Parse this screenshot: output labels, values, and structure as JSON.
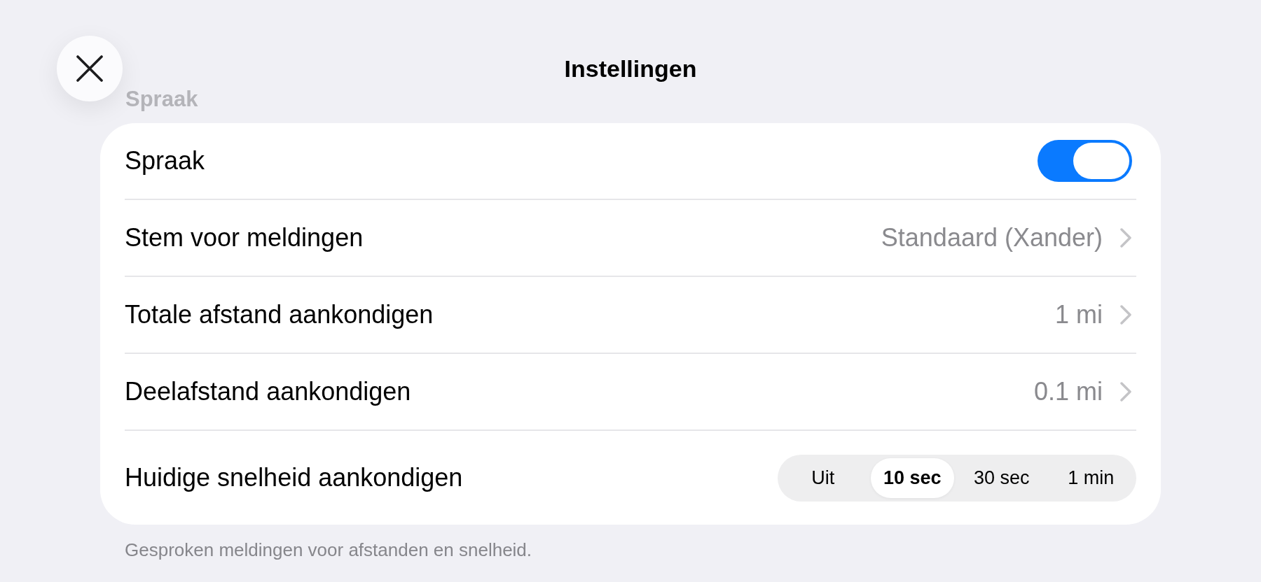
{
  "header": {
    "title": "Instellingen"
  },
  "section": {
    "heading": "Spraak",
    "rows": [
      {
        "kind": "toggle",
        "label": "Spraak",
        "on": true
      },
      {
        "kind": "link",
        "label": "Stem voor meldingen",
        "value": "Standaard (Xander)"
      },
      {
        "kind": "link",
        "label": "Totale afstand aankondigen",
        "value": "1 mi"
      },
      {
        "kind": "link",
        "label": "Deelafstand aankondigen",
        "value": "0.1 mi"
      },
      {
        "kind": "segmented",
        "label": "Huidige snelheid aankondigen",
        "options": [
          {
            "label": "Uit",
            "selected": false
          },
          {
            "label": "10 sec",
            "selected": true
          },
          {
            "label": "30 sec",
            "selected": false
          },
          {
            "label": "1 min",
            "selected": false
          }
        ]
      }
    ],
    "footer": "Gesproken meldingen voor afstanden en snelheid."
  }
}
